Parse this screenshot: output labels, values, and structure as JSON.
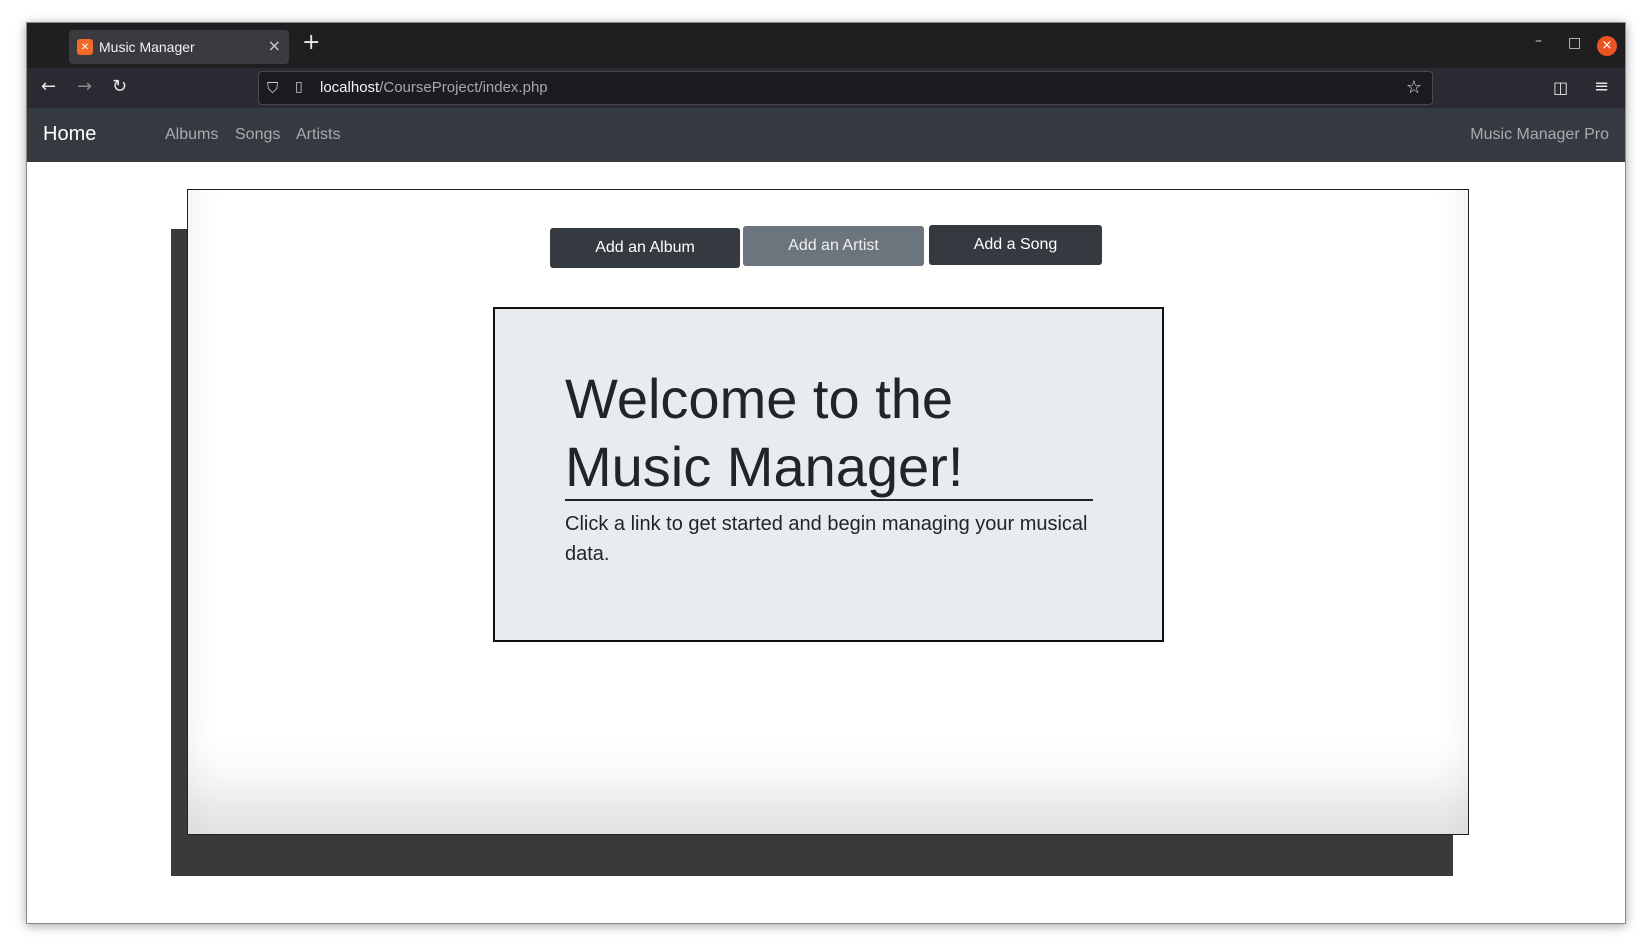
{
  "browser": {
    "tab_title": "Music Manager",
    "tab_favicon": "xampp-icon",
    "url_host": "localhost",
    "url_path": "/CourseProject/index.php"
  },
  "navbar": {
    "brand": "Home",
    "links": [
      "Albums",
      "Songs",
      "Artists"
    ],
    "right_text": "Music Manager Pro"
  },
  "actions": {
    "add_album": "Add an Album",
    "add_artist": "Add an Artist",
    "add_song": "Add a Song"
  },
  "jumbotron": {
    "title": "Welcome to the Music Manager!",
    "text": "Click a link to get started and begin managing your musical data."
  },
  "colors": {
    "navbar_bg": "#343a40",
    "secondary_button": "#6c757d",
    "jumbotron_bg": "#e9ecef",
    "close_button": "#e95420"
  }
}
